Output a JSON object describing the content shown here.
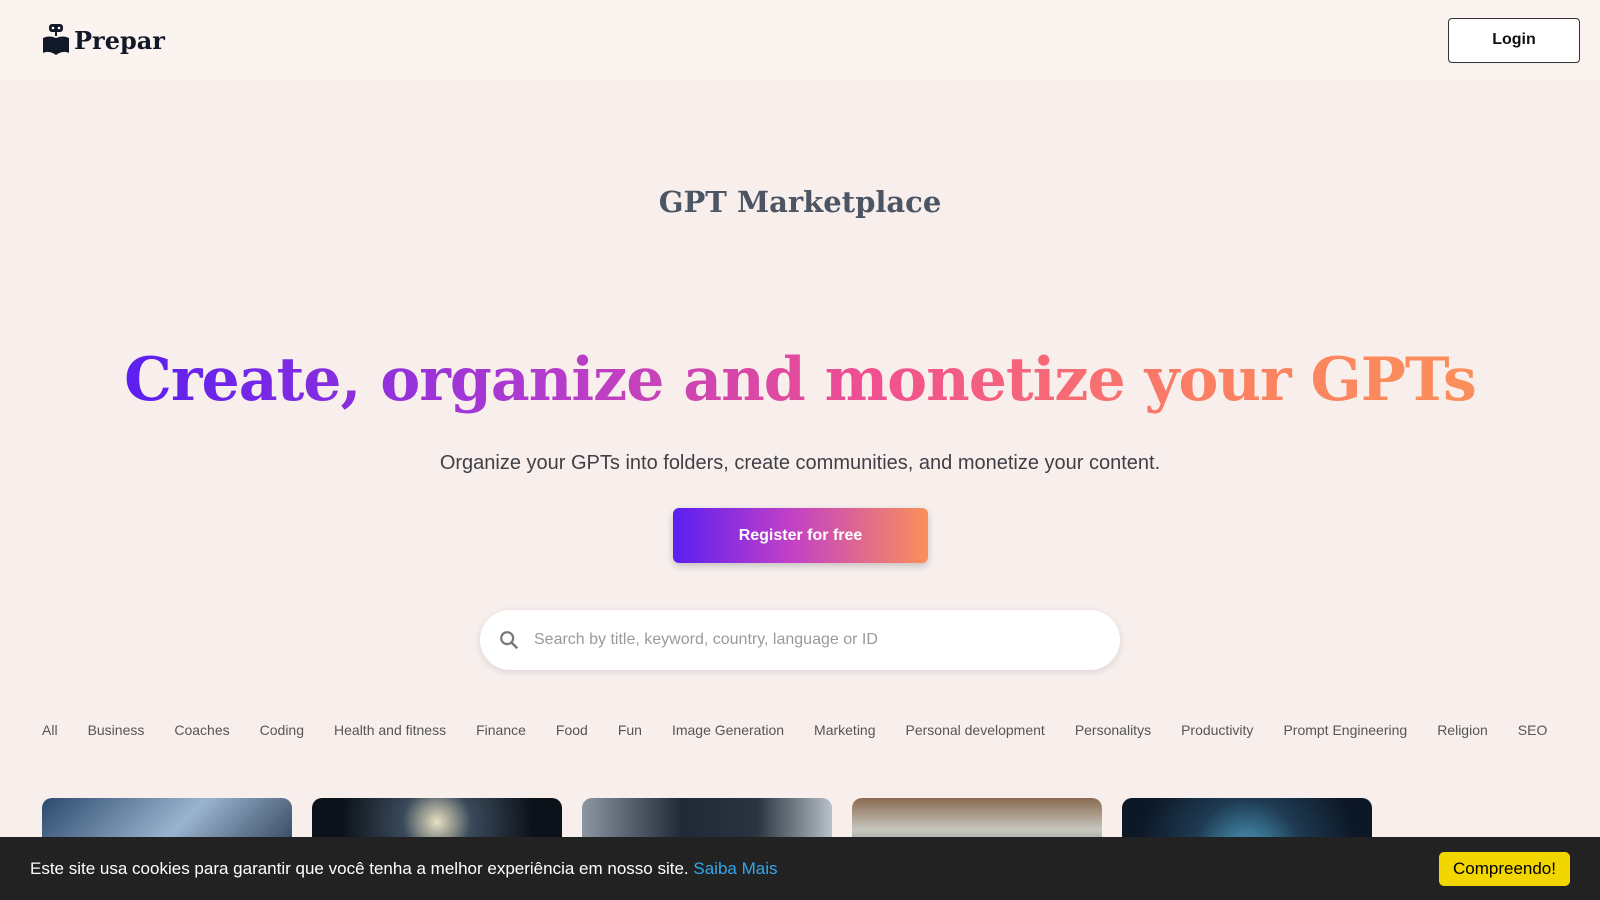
{
  "header": {
    "brand": "Prepar",
    "login_label": "Login"
  },
  "main": {
    "title": "GPT Marketplace",
    "hero": "Create, organize and monetize your GPTs",
    "subtitle": "Organize your GPTs into folders, create communities, and monetize your content.",
    "register_label": "Register for free",
    "search_placeholder": "Search by title, keyword, country, language or ID",
    "categories": [
      "All",
      "Business",
      "Coaches",
      "Coding",
      "Health and fitness",
      "Finance",
      "Food",
      "Fun",
      "Image Generation",
      "Marketing",
      "Personal development",
      "Personalitys",
      "Productivity",
      "Prompt Engineering",
      "Religion",
      "SEO"
    ]
  },
  "cookie": {
    "text": "Este site usa cookies para garantir que você tenha a melhor experiência em nosso site.",
    "link": "Saiba Mais",
    "accept": "Compreendo!"
  }
}
